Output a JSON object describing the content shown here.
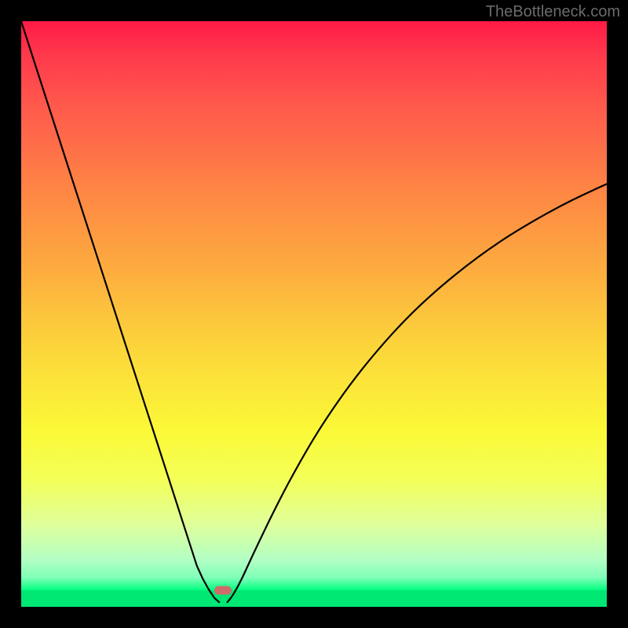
{
  "watermark": "TheBottleneck.com",
  "chart_data": {
    "type": "line",
    "title": "",
    "xlabel": "",
    "ylabel": "",
    "xlim": [
      0,
      100
    ],
    "ylim": [
      0,
      100
    ],
    "grid": false,
    "background": "red-yellow-green vertical gradient",
    "series": [
      {
        "name": "curve-left",
        "x": [
          0.0,
          2.0,
          4.0,
          6.0,
          8.0,
          10.0,
          12.0,
          14.0,
          16.0,
          18.0,
          20.0,
          22.0,
          24.0,
          26.0,
          28.0,
          30.0,
          31.0,
          32.0,
          33.0,
          33.8
        ],
        "y": [
          100.0,
          93.8,
          87.6,
          81.4,
          75.2,
          69.0,
          62.8,
          56.6,
          50.4,
          44.2,
          38.0,
          31.8,
          25.6,
          19.4,
          13.2,
          7.0,
          4.8,
          3.0,
          1.5,
          0.8
        ]
      },
      {
        "name": "curve-right",
        "x": [
          35.2,
          36.0,
          37.0,
          38.0,
          40.0,
          43.0,
          46.0,
          50.0,
          54.0,
          58.0,
          62.0,
          66.0,
          70.0,
          74.0,
          78.0,
          82.0,
          86.0,
          90.0,
          94.0,
          98.0,
          100.0
        ],
        "y": [
          0.8,
          1.8,
          3.5,
          5.5,
          9.8,
          16.0,
          21.8,
          28.8,
          34.9,
          40.3,
          45.1,
          49.4,
          53.2,
          56.6,
          59.7,
          62.5,
          65.0,
          67.3,
          69.4,
          71.3,
          72.2
        ]
      }
    ],
    "marker": {
      "x": 34.5,
      "y": 2.8,
      "shape": "rounded-rect",
      "color": "#cf6b6b"
    }
  },
  "colors": {
    "curve_stroke": "#000000",
    "frame": "#000000"
  }
}
